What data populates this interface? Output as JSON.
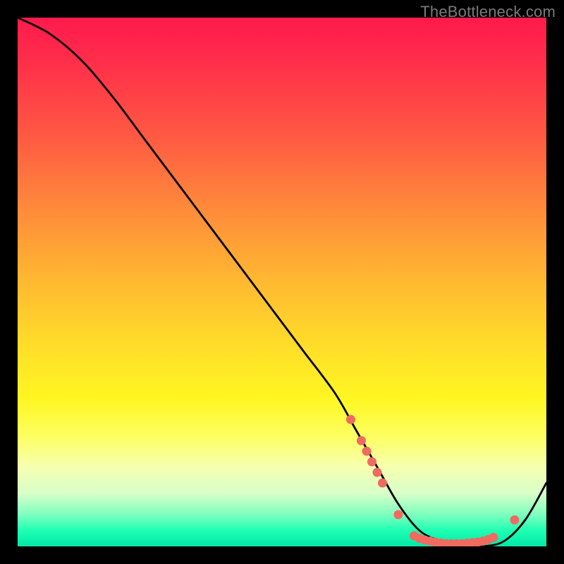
{
  "watermark": "TheBottleneck.com",
  "chart_data": {
    "type": "line",
    "title": "",
    "xlabel": "",
    "ylabel": "",
    "xlim": [
      0,
      100
    ],
    "ylim": [
      0,
      100
    ],
    "grid": false,
    "legend": false,
    "series": [
      {
        "name": "bottleneck-curve",
        "x": [
          0,
          6,
          12,
          18,
          24,
          30,
          36,
          42,
          48,
          54,
          60,
          64,
          68,
          72,
          76,
          80,
          84,
          88,
          92,
          96,
          100
        ],
        "y": [
          100,
          97,
          92,
          85,
          77,
          69,
          61,
          53,
          45,
          37,
          29,
          22,
          15,
          8,
          3,
          1,
          0,
          0,
          1,
          5,
          12
        ]
      }
    ],
    "markers": {
      "name": "highlight-points",
      "color": "#ef6a60",
      "points": [
        {
          "x": 63,
          "y": 24
        },
        {
          "x": 65,
          "y": 20
        },
        {
          "x": 66,
          "y": 18
        },
        {
          "x": 67,
          "y": 16
        },
        {
          "x": 68,
          "y": 14
        },
        {
          "x": 69,
          "y": 12
        },
        {
          "x": 72,
          "y": 6
        },
        {
          "x": 75,
          "y": 2
        },
        {
          "x": 76,
          "y": 1.5
        },
        {
          "x": 77,
          "y": 1.2
        },
        {
          "x": 78,
          "y": 1
        },
        {
          "x": 79,
          "y": 0.8
        },
        {
          "x": 80,
          "y": 0.6
        },
        {
          "x": 81,
          "y": 0.5
        },
        {
          "x": 82,
          "y": 0.5
        },
        {
          "x": 83,
          "y": 0.5
        },
        {
          "x": 84,
          "y": 0.5
        },
        {
          "x": 85,
          "y": 0.6
        },
        {
          "x": 86,
          "y": 0.7
        },
        {
          "x": 87,
          "y": 0.8
        },
        {
          "x": 88,
          "y": 1
        },
        {
          "x": 89,
          "y": 1.3
        },
        {
          "x": 90,
          "y": 1.7
        },
        {
          "x": 94,
          "y": 5
        }
      ]
    },
    "background_gradient": {
      "direction": "vertical",
      "stops": [
        {
          "pos": 0.0,
          "color": "#ff1a4d"
        },
        {
          "pos": 0.5,
          "color": "#ffe028"
        },
        {
          "pos": 0.85,
          "color": "#f6ffb0"
        },
        {
          "pos": 1.0,
          "color": "#00e8a8"
        }
      ]
    }
  }
}
